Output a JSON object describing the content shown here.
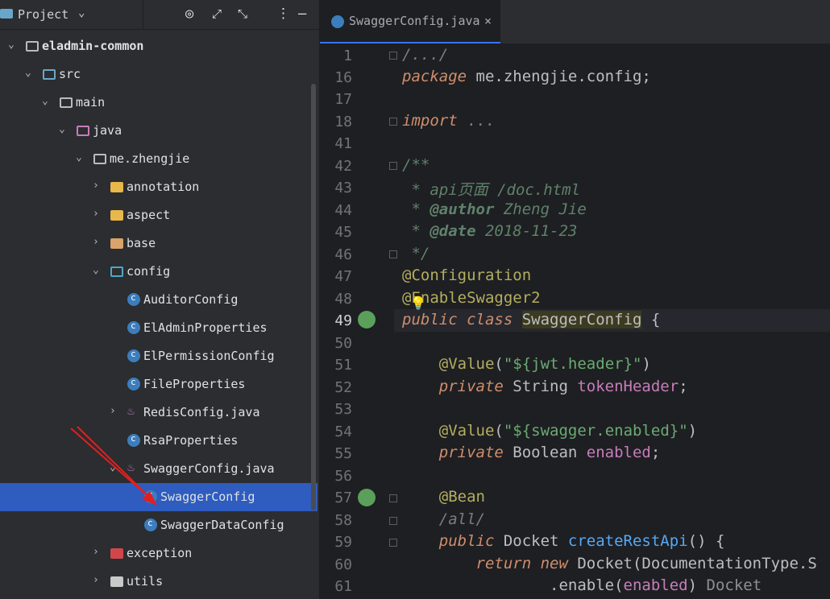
{
  "project_panel": {
    "title": "Project",
    "toolbar_icons": [
      "target-icon",
      "expand-icon",
      "collapse-icon",
      "more-icon",
      "minimize-icon"
    ],
    "tree": [
      {
        "label": "eladmin-common",
        "icon": "module-folder-icon",
        "expanded": true,
        "bold": true
      },
      {
        "label": "src",
        "icon": "source-folder-icon",
        "expanded": true
      },
      {
        "label": "main",
        "icon": "folder-icon",
        "expanded": true
      },
      {
        "label": "java",
        "icon": "source-root-icon",
        "expanded": true
      },
      {
        "label": "me.zhengjie",
        "icon": "package-icon",
        "expanded": true
      },
      {
        "label": "annotation",
        "icon": "package-icon",
        "expanded": false
      },
      {
        "label": "aspect",
        "icon": "package-icon",
        "expanded": false
      },
      {
        "label": "base",
        "icon": "package-icon",
        "expanded": false
      },
      {
        "label": "config",
        "icon": "config-package-icon",
        "expanded": true
      },
      {
        "label": "AuditorConfig",
        "icon": "class-icon"
      },
      {
        "label": "ElAdminProperties",
        "icon": "class-icon"
      },
      {
        "label": "ElPermissionConfig",
        "icon": "class-icon"
      },
      {
        "label": "FileProperties",
        "icon": "class-icon"
      },
      {
        "label": "RedisConfig.java",
        "icon": "java-file-icon",
        "expanded": false
      },
      {
        "label": "RsaProperties",
        "icon": "class-icon"
      },
      {
        "label": "SwaggerConfig.java",
        "icon": "java-file-icon",
        "expanded": true
      },
      {
        "label": "SwaggerConfig",
        "icon": "class-icon",
        "selected": true
      },
      {
        "label": "SwaggerDataConfig",
        "icon": "class-icon"
      },
      {
        "label": "exception",
        "icon": "package-icon",
        "expanded": false
      },
      {
        "label": "utils",
        "icon": "package-icon",
        "expanded": false
      }
    ]
  },
  "editor": {
    "tab_label": "SwaggerConfig.java",
    "tab_close": "×",
    "current_line": "49",
    "line_numbers": [
      "1",
      "16",
      "17",
      "18",
      "41",
      "42",
      "43",
      "44",
      "45",
      "46",
      "47",
      "48",
      "49",
      "50",
      "51",
      "52",
      "53",
      "54",
      "55",
      "56",
      "57",
      "58",
      "59",
      "60",
      "61"
    ]
  },
  "colors": {
    "selection": "#2e5cbf",
    "accent": "#3574f0",
    "annotation_arrow": "#e02020"
  }
}
